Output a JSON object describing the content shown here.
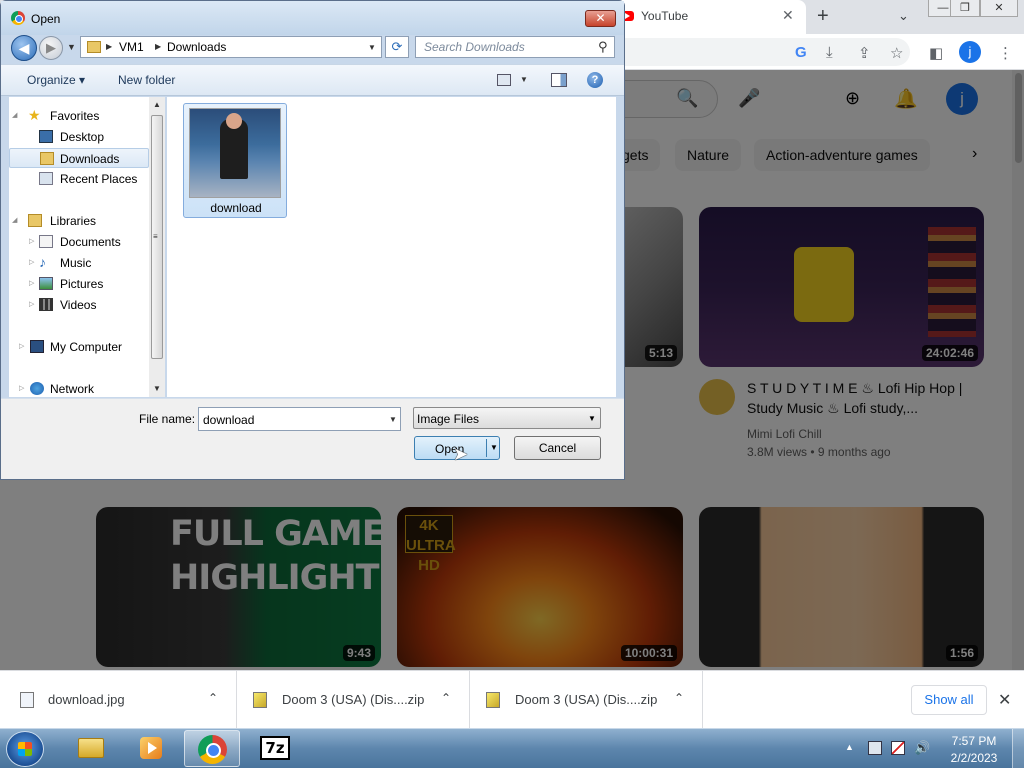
{
  "browser": {
    "tab_title": "YouTube",
    "tab_close": "✕",
    "new_tab": "+",
    "tab_search": "⌄",
    "window_controls": [
      "—",
      "❐",
      "✕"
    ],
    "toolbar_icons": [
      "G",
      "⤓",
      "⇪",
      "☆",
      "◧",
      "j",
      "⋮"
    ]
  },
  "youtube": {
    "header": {
      "search_icon": "🔍",
      "mic_icon": "🎤",
      "create_icon": "⊕",
      "bell_icon": "🔔",
      "avatar": "j"
    },
    "chips": [
      "gets",
      "Nature",
      "Action-adventure games"
    ],
    "chip_next": "›",
    "videos": [
      {
        "duration": "5:13"
      },
      {
        "duration": "24:02:46",
        "title": "S T U D Y   T I M E ♨ Lofi Hip Hop | Study Music ♨ Lofi study,...",
        "channel": "Mimi Lofi Chill",
        "meta": "3.8M views • 9 months ago"
      },
      {
        "duration": "9:43",
        "overlay": "FULL GAME HIGHLIGHTS"
      },
      {
        "duration": "10:00:31",
        "badge": "4K ULTRA HD"
      },
      {
        "duration": "1:56"
      }
    ]
  },
  "downloads": {
    "items": [
      {
        "name": "download.jpg"
      },
      {
        "name": "Doom 3 (USA) (Dis....zip"
      },
      {
        "name": "Doom 3 (USA) (Dis....zip"
      }
    ],
    "show_all": "Show all",
    "close": "✕"
  },
  "dialog": {
    "title": "Open",
    "close": "✕",
    "breadcrumb": [
      "VM1",
      "Downloads"
    ],
    "search_placeholder": "Search Downloads",
    "organize": "Organize ▾",
    "new_folder": "New folder",
    "help": "?",
    "nav": [
      {
        "label": "Favorites"
      },
      {
        "label": "Desktop"
      },
      {
        "label": "Downloads"
      },
      {
        "label": "Recent Places"
      },
      {
        "label": "Libraries"
      },
      {
        "label": "Documents"
      },
      {
        "label": "Music"
      },
      {
        "label": "Pictures"
      },
      {
        "label": "Videos"
      },
      {
        "label": "My Computer"
      },
      {
        "label": "Network"
      }
    ],
    "selected_nav": "Downloads",
    "file": {
      "name": "download"
    },
    "file_name_label": "File name:",
    "file_name_value": "download",
    "file_type": "Image Files",
    "open_label": "Open",
    "cancel_label": "Cancel"
  },
  "taskbar": {
    "apps": [
      "Windows Explorer",
      "Windows Media Player",
      "Google Chrome",
      "7-Zip"
    ],
    "active_app": "Google Chrome",
    "clock_time": "7:57 PM",
    "clock_date": "2/2/2023"
  }
}
